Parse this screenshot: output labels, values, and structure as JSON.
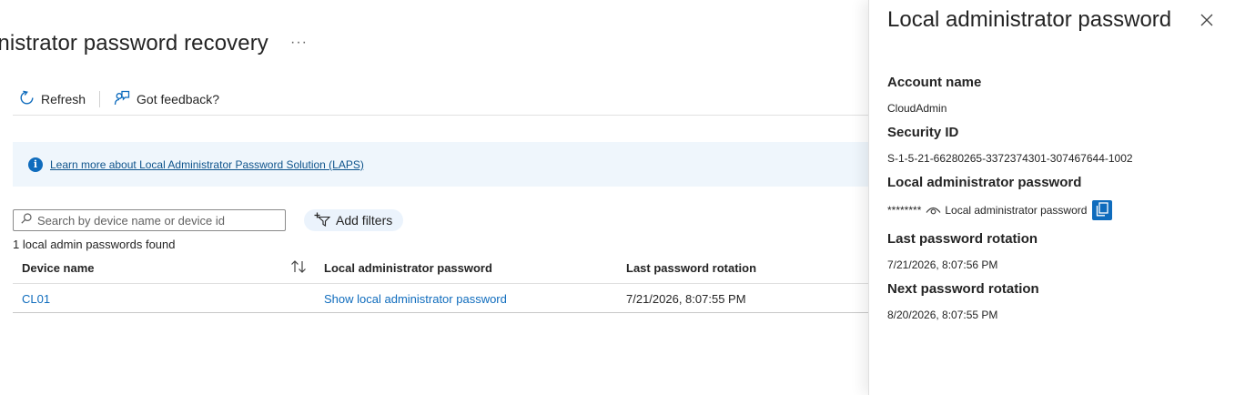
{
  "page": {
    "title": "inistrator password recovery",
    "more_label": "···"
  },
  "toolbar": {
    "refresh_label": "Refresh",
    "feedback_label": "Got feedback?"
  },
  "info": {
    "link_text": "Learn more about Local Administrator Password Solution (LAPS)"
  },
  "search": {
    "placeholder": "Search by device name or device id",
    "value": ""
  },
  "filters": {
    "add_label": "Add filters"
  },
  "results": {
    "count_text": "1 local admin passwords found"
  },
  "table": {
    "columns": [
      "Device name",
      "Local administrator password",
      "Last password rotation"
    ],
    "rows": [
      {
        "device": "CL01",
        "password_link": "Show local administrator password",
        "last_rotation": "7/21/2026, 8:07:55 PM"
      }
    ]
  },
  "panel": {
    "title": "Local administrator password",
    "account_name_label": "Account name",
    "account_name": "CloudAdmin",
    "security_id_label": "Security ID",
    "security_id": "S-1-5-21-66280265-3372374301-307467644-1002",
    "password_label": "Local administrator password",
    "password_masked": "********",
    "password_show_label": "Local administrator password",
    "last_rotation_label": "Last password rotation",
    "last_rotation": "7/21/2026, 8:07:56 PM",
    "next_rotation_label": "Next password rotation",
    "next_rotation": "8/20/2026, 8:07:55 PM"
  },
  "colors": {
    "accent": "#0f6cbd",
    "info_background": "#eff6fc",
    "filter_background": "#ebf3fc"
  }
}
